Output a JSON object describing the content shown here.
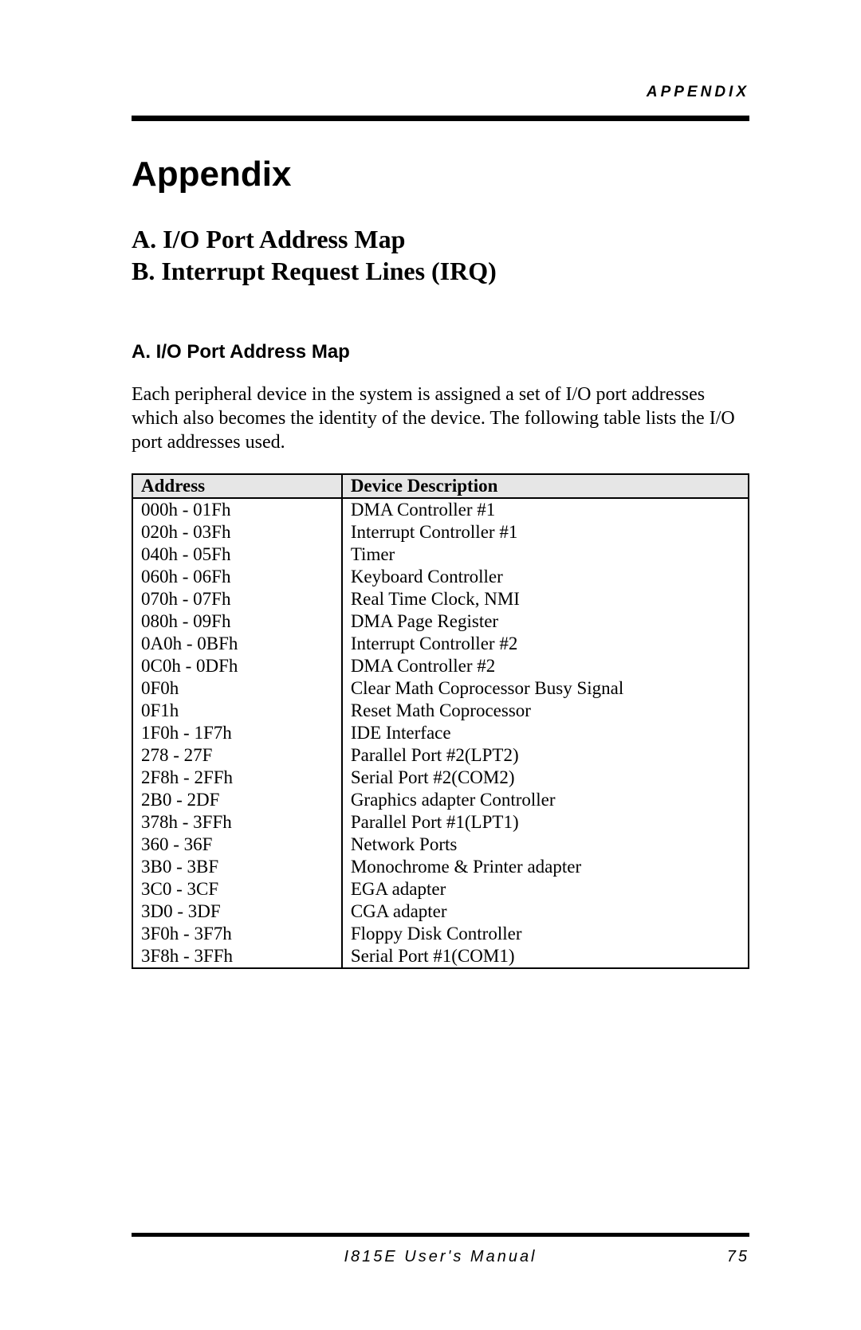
{
  "header": {
    "label": "APPENDIX"
  },
  "title": "Appendix",
  "subtitle_a": "A. I/O Port Address Map",
  "subtitle_b": "B. Interrupt Request Lines (IRQ)",
  "section_a": {
    "heading": "A. I/O Port Address Map",
    "paragraph": "Each peripheral device in the system is assigned a set of I/O port addresses which also becomes the identity of the device. The following table lists the I/O port addresses used."
  },
  "table": {
    "headers": {
      "address": "Address",
      "description": "Device Description"
    },
    "rows": [
      {
        "address": "000h - 01Fh",
        "description": "DMA Controller #1"
      },
      {
        "address": "020h - 03Fh",
        "description": "Interrupt Controller #1"
      },
      {
        "address": "040h - 05Fh",
        "description": "Timer"
      },
      {
        "address": "060h - 06Fh",
        "description": "Keyboard Controller"
      },
      {
        "address": "070h - 07Fh",
        "description": "Real Time Clock, NMI"
      },
      {
        "address": "080h - 09Fh",
        "description": "DMA Page Register"
      },
      {
        "address": "0A0h - 0BFh",
        "description": "Interrupt Controller #2"
      },
      {
        "address": "0C0h - 0DFh",
        "description": "DMA Controller #2"
      },
      {
        "address": "0F0h",
        "description": "Clear Math Coprocessor Busy Signal"
      },
      {
        "address": "0F1h",
        "description": "Reset Math Coprocessor"
      },
      {
        "address": "1F0h - 1F7h",
        "description": "IDE Interface"
      },
      {
        "address": "278 - 27F",
        "description": "Parallel Port #2(LPT2)"
      },
      {
        "address": "2F8h - 2FFh",
        "description": "Serial Port #2(COM2)"
      },
      {
        "address": "2B0 - 2DF",
        "description": "Graphics adapter Controller"
      },
      {
        "address": "378h - 3FFh",
        "description": "Parallel Port #1(LPT1)"
      },
      {
        "address": "360 - 36F",
        "description": "Network Ports"
      },
      {
        "address": "3B0 - 3BF",
        "description": "Monochrome & Printer adapter"
      },
      {
        "address": "3C0 - 3CF",
        "description": "EGA adapter"
      },
      {
        "address": "3D0 - 3DF",
        "description": "CGA adapter"
      },
      {
        "address": "3F0h - 3F7h",
        "description": "Floppy Disk Controller"
      },
      {
        "address": "3F8h - 3FFh",
        "description": "Serial Port #1(COM1)"
      }
    ]
  },
  "footer": {
    "manual": "I815E User's Manual",
    "page": "75"
  }
}
